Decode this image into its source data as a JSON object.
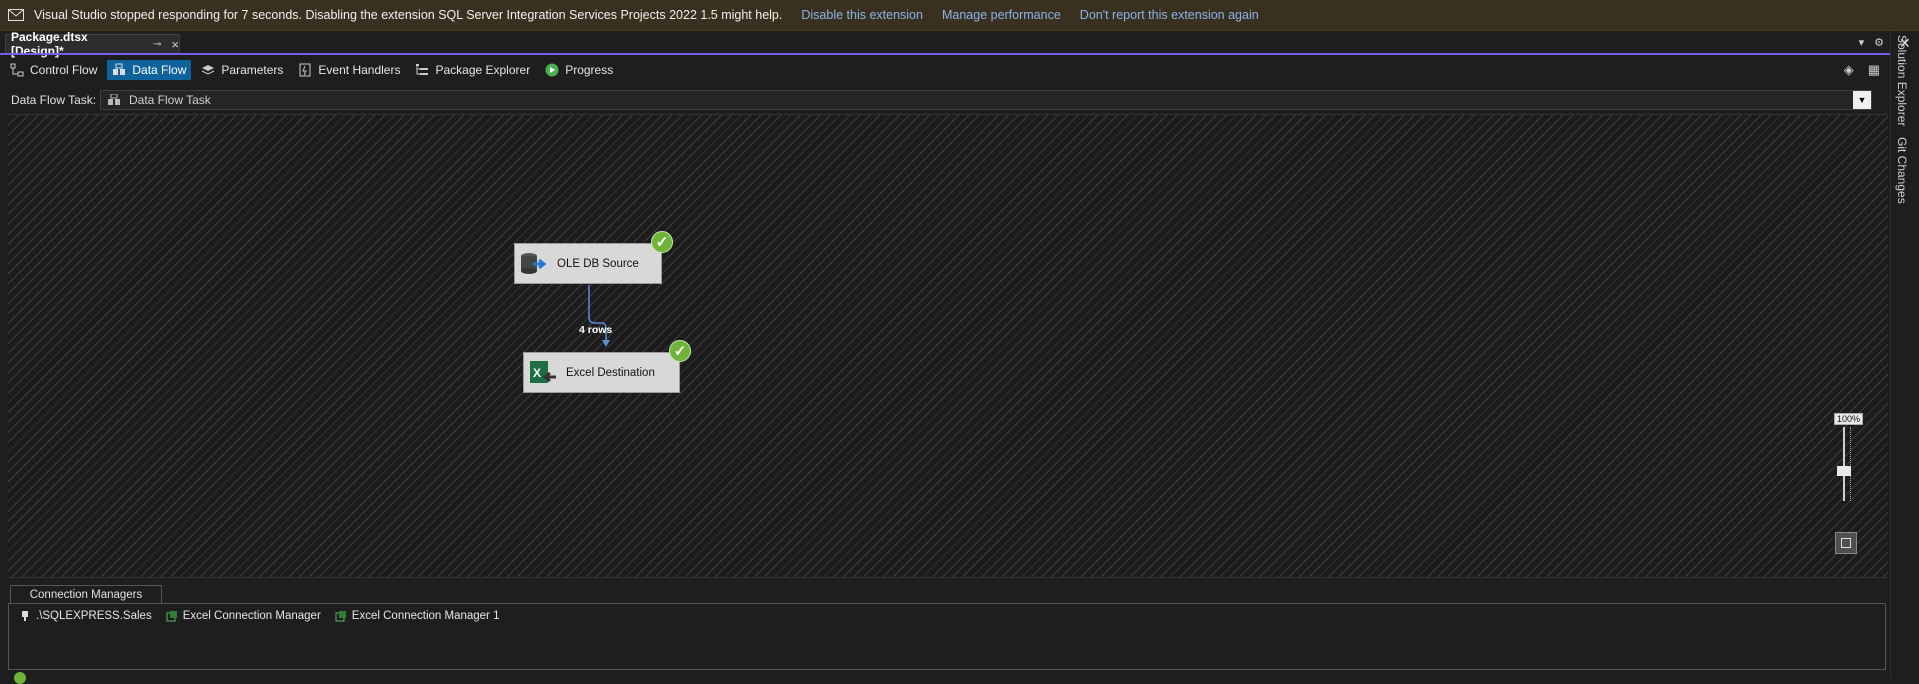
{
  "infobar": {
    "message": "Visual Studio stopped responding for 7 seconds. Disabling the extension SQL Server Integration Services Projects 2022 1.5 might help.",
    "links": [
      "Disable this extension",
      "Manage performance",
      "Don't report this extension again"
    ],
    "close_icon": "close-icon"
  },
  "document_tab": {
    "title": "Package.dtsx [Design]*",
    "pin": "⊸",
    "close": "×"
  },
  "designer_tabs": [
    {
      "label": "Control Flow",
      "icon": "control-flow-icon",
      "active": false
    },
    {
      "label": "Data Flow",
      "icon": "data-flow-icon",
      "active": true
    },
    {
      "label": "Parameters",
      "icon": "parameters-icon",
      "active": false
    },
    {
      "label": "Event Handlers",
      "icon": "event-handlers-icon",
      "active": false
    },
    {
      "label": "Package Explorer",
      "icon": "package-explorer-icon",
      "active": false
    },
    {
      "label": "Progress",
      "icon": "progress-icon",
      "active": false
    }
  ],
  "task_row": {
    "label": "Data Flow Task:",
    "selected": "Data Flow Task"
  },
  "canvas": {
    "nodes": [
      {
        "label": "OLE DB Source",
        "icon": "ole-db-source-icon",
        "status": "success"
      },
      {
        "label": "Excel Destination",
        "icon": "excel-destination-icon",
        "status": "success"
      }
    ],
    "path_label": "4 rows",
    "zoom": "100%",
    "checkmark": "✓"
  },
  "connection_managers": {
    "tab_label": "Connection Managers",
    "items": [
      {
        "label": ".\\SQLEXPRESS.Sales",
        "icon": "database-connection-icon"
      },
      {
        "label": "Excel Connection Manager",
        "icon": "excel-connection-icon"
      },
      {
        "label": "Excel Connection Manager 1",
        "icon": "excel-connection-icon"
      }
    ]
  },
  "side_tabs": [
    "Solution Explorer",
    "Git Changes"
  ],
  "colors": {
    "accent": "#7160e8",
    "active_tab": "#0e639c",
    "success": "#6fb33a",
    "infobar_bg": "#3a3020",
    "link": "#8ab4e8"
  }
}
